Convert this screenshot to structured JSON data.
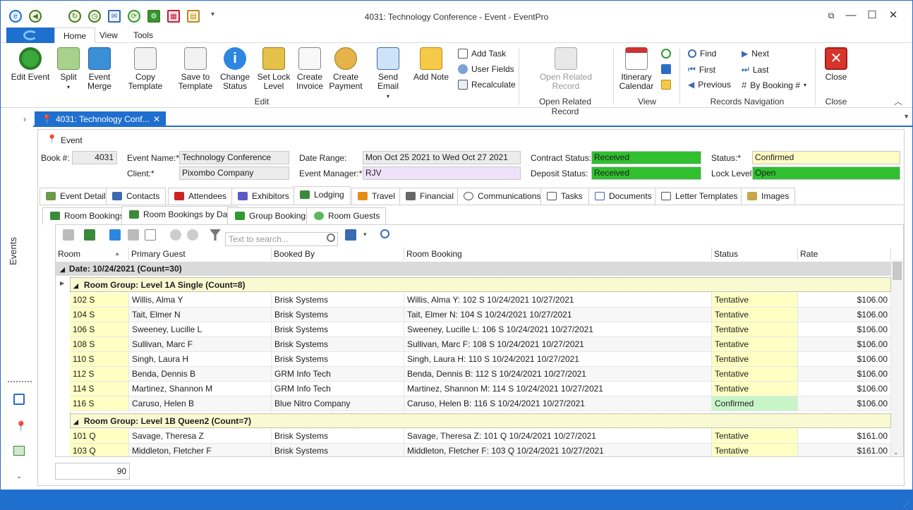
{
  "window": {
    "title": "4031: Technology Conference - Event - EventPro"
  },
  "menu": {
    "tabs": [
      "Home",
      "View",
      "Tools"
    ]
  },
  "ribbon": {
    "buttons": {
      "edit_event": "Edit Event",
      "split": "Split",
      "event_merge": "Event Merge",
      "copy_template": "Copy Template",
      "save_to_template": "Save to Template",
      "change_status": "Change Status",
      "set_lock_level": "Set Lock Level",
      "create_invoice": "Create Invoice",
      "create_payment": "Create Payment",
      "send_email": "Send Email",
      "add_note": "Add Note",
      "add_task": "Add Task",
      "user_fields": "User Fields",
      "recalculate": "Recalculate",
      "open_related_record": "Open Related Record",
      "itinerary_calendar": "Itinerary Calendar",
      "find": "Find",
      "first": "First",
      "previous": "Previous",
      "next": "Next",
      "last": "Last",
      "by_booking": "By Booking #",
      "close": "Close"
    },
    "groups": {
      "edit": "Edit",
      "open_related": "Open Related Record",
      "view": "View",
      "records_nav": "Records Navigation",
      "close": "Close"
    }
  },
  "sidebar": {
    "label": "Events"
  },
  "doc_tab": {
    "label": "4031: Technology Conf..."
  },
  "event": {
    "section_title": "Event",
    "book_label": "Book #:",
    "book_value": "4031",
    "event_name_label": "Event Name:*",
    "event_name_value": "Technology Conference",
    "client_label": "Client:*",
    "client_value": "Pixombo Company",
    "date_range_label": "Date Range:",
    "date_range_value": "Mon Oct 25 2021 to Wed Oct 27 2021",
    "event_manager_label": "Event Manager:*",
    "event_manager_value": "RJV",
    "contract_status_label": "Contract Status:",
    "contract_status_value": "Received",
    "deposit_status_label": "Deposit Status:",
    "deposit_status_value": "Received",
    "status_label": "Status:*",
    "status_value": "Confirmed",
    "lock_level_label": "Lock Level:",
    "lock_level_value": "Open"
  },
  "main_tabs": [
    "Event Detail",
    "Contacts",
    "Attendees",
    "Exhibitors",
    "Lodging",
    "Travel",
    "Financial",
    "Communications",
    "Tasks",
    "Documents",
    "Letter Templates",
    "Images"
  ],
  "sub_tabs": [
    "Room Bookings",
    "Room Bookings by Day",
    "Group Bookings",
    "Room Guests"
  ],
  "grid": {
    "search_placeholder": "Text to search...",
    "columns": [
      "Room",
      "Primary Guest",
      "Booked By",
      "Room Booking",
      "Status",
      "Rate"
    ],
    "date_group": "Date: 10/24/2021 (Count=30)",
    "groups": [
      {
        "title": "Room Group: Level 1A Single (Count=8)",
        "rows": [
          [
            "102 S",
            "Willis, Alma Y",
            "Brisk Systems",
            "Willis, Alma Y: 102 S 10/24/2021 10/27/2021",
            "Tentative",
            "$106.00"
          ],
          [
            "104 S",
            "Tait, Elmer N",
            "Brisk Systems",
            "Tait, Elmer N: 104 S 10/24/2021 10/27/2021",
            "Tentative",
            "$106.00"
          ],
          [
            "106 S",
            "Sweeney, Lucille L",
            "Brisk Systems",
            "Sweeney, Lucille L: 106 S 10/24/2021 10/27/2021",
            "Tentative",
            "$106.00"
          ],
          [
            "108 S",
            "Sullivan, Marc F",
            "Brisk Systems",
            "Sullivan, Marc F: 108 S 10/24/2021 10/27/2021",
            "Tentative",
            "$106.00"
          ],
          [
            "110 S",
            "Singh, Laura H",
            "Brisk Systems",
            "Singh, Laura H: 110 S 10/24/2021 10/27/2021",
            "Tentative",
            "$106.00"
          ],
          [
            "112 S",
            "Benda, Dennis B",
            "GRM Info Tech",
            "Benda, Dennis B: 112 S 10/24/2021 10/27/2021",
            "Tentative",
            "$106.00"
          ],
          [
            "114 S",
            "Martinez, Shannon M",
            "GRM Info Tech",
            "Martinez, Shannon M: 114 S 10/24/2021 10/27/2021",
            "Tentative",
            "$106.00"
          ],
          [
            "116 S",
            "Caruso, Helen B",
            "Blue Nitro Company",
            "Caruso, Helen B: 116 S 10/24/2021 10/27/2021",
            "Confirmed",
            "$106.00"
          ]
        ]
      },
      {
        "title": "Room Group: Level 1B Queen2 (Count=7)",
        "rows": [
          [
            "101 Q",
            "Savage, Theresa Z",
            "Brisk Systems",
            "Savage, Theresa Z: 101 Q 10/24/2021 10/27/2021",
            "Tentative",
            "$161.00"
          ],
          [
            "103 Q",
            "Middleton, Fletcher F",
            "Brisk Systems",
            "Middleton, Fletcher F: 103 Q 10/24/2021 10/27/2021",
            "Tentative",
            "$161.00"
          ]
        ]
      }
    ],
    "footer_count": "90"
  },
  "colors": {
    "accent": "#1f6fcf",
    "tentative": "#ffffc4",
    "confirmed": "#c8f5c8",
    "received": "#2fbf2f",
    "group_bg": "#fafad2"
  }
}
